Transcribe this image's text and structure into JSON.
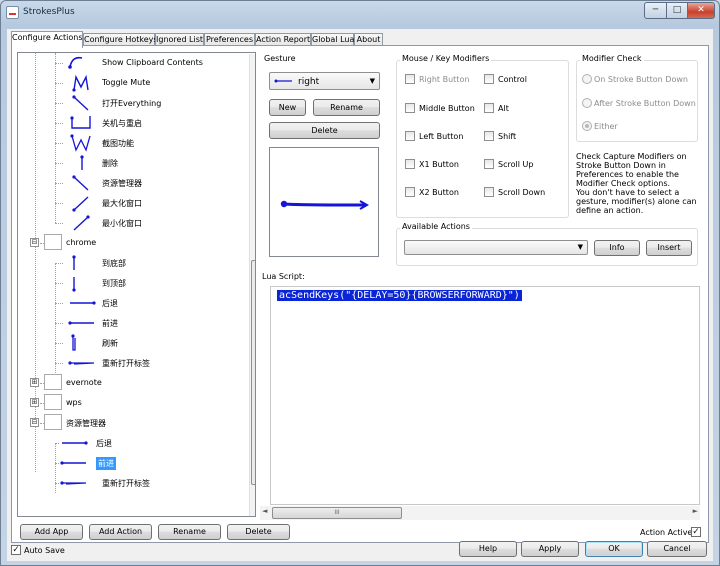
{
  "window": {
    "title": "StrokesPlus",
    "min": "─",
    "max": "□",
    "close": "✕"
  },
  "tabs": [
    {
      "label": "Configure Actions",
      "active": true
    },
    {
      "label": "Configure Hotkeys"
    },
    {
      "label": "Ignored List"
    },
    {
      "label": "Preferences"
    },
    {
      "label": "Action Report"
    },
    {
      "label": "Global Lua"
    },
    {
      "label": "About"
    }
  ],
  "tree": {
    "items": [
      {
        "label": "Show Clipboard Contents",
        "icon": "gesture-curve-icon"
      },
      {
        "label": "Toggle Mute",
        "icon": "gesture-m-icon"
      },
      {
        "label": "打开Everything",
        "icon": "gesture-diagonal-icon"
      },
      {
        "label": "关机与重启",
        "icon": "gesture-hook-icon"
      },
      {
        "label": "截图功能",
        "icon": "gesture-w-icon"
      },
      {
        "label": "删除",
        "icon": "gesture-down-icon"
      },
      {
        "label": "资源管理器",
        "icon": "gesture-diagonal-icon"
      },
      {
        "label": "最大化窗口",
        "icon": "gesture-up-right-icon"
      },
      {
        "label": "最小化窗口",
        "icon": "gesture-up-right-icon"
      },
      {
        "label": "chrome",
        "icon": "app-icon",
        "group": true
      },
      {
        "label": "到底部",
        "icon": "gesture-down-icon"
      },
      {
        "label": "到顶部",
        "icon": "gesture-up-icon"
      },
      {
        "label": "后退",
        "icon": "gesture-left-icon"
      },
      {
        "label": "前进",
        "icon": "gesture-right-icon"
      },
      {
        "label": "刷新",
        "icon": "gesture-down-up-icon"
      },
      {
        "label": "重新打开标签",
        "icon": "gesture-right-left-icon"
      },
      {
        "label": "evernote",
        "icon": "app-icon",
        "group": true
      },
      {
        "label": "wps",
        "icon": "app-icon",
        "group": true
      },
      {
        "label": "资源管理器",
        "icon": "app-icon",
        "group": true
      },
      {
        "label": "后退",
        "icon": "gesture-left-icon"
      },
      {
        "label": "前进",
        "icon": "gesture-right-icon",
        "selected": true
      },
      {
        "label": "重新打开标签",
        "icon": "gesture-right-left-icon"
      }
    ],
    "expanders": [
      "⊟",
      "⊞",
      "⊞",
      "⊟"
    ]
  },
  "left_buttons": {
    "add_app": "Add App",
    "add_action": "Add Action",
    "rename": "Rename",
    "delete": "Delete"
  },
  "gesture": {
    "title": "Gesture",
    "selected": "right",
    "new": "New",
    "rename": "Rename",
    "delete": "Delete"
  },
  "modifiers": {
    "title": "Mouse / Key Modifiers",
    "items": [
      "Right Button",
      "Control",
      "Middle Button",
      "Alt",
      "Left Button",
      "Shift",
      "X1 Button",
      "Scroll Up",
      "X2 Button",
      "Scroll Down"
    ]
  },
  "modifier_check": {
    "title": "Modifier Check",
    "options": [
      "On Stroke Button Down",
      "After Stroke Button Down",
      "Either"
    ],
    "desc1": "Check Capture Modifiers on Stroke Button Down in Preferences to enable the Modifier Check options.",
    "desc2": "You don't have to select a gesture, modifier(s) alone can define an action."
  },
  "available_actions": {
    "title": "Available Actions",
    "info": "Info",
    "insert": "Insert"
  },
  "lua": {
    "label": "Lua Script:",
    "code": "acSendKeys(\"{DELAY=50}{BROWSERFORWARD}\")"
  },
  "action_active": {
    "label": "Action Active",
    "checked": "✓"
  },
  "footer": {
    "auto_save": "Auto Save",
    "auto_save_check": "✓",
    "help": "Help",
    "apply": "Apply",
    "ok": "OK",
    "cancel": "Cancel"
  },
  "scroll": {
    "up": "▲",
    "down": "▼",
    "left": "◄",
    "right": "►",
    "grip": "≡",
    "hgrip": "III"
  },
  "colors": {
    "selection": "#3399ff",
    "gesture_stroke": "#1515d6",
    "code_bg": "#0a24d8"
  }
}
